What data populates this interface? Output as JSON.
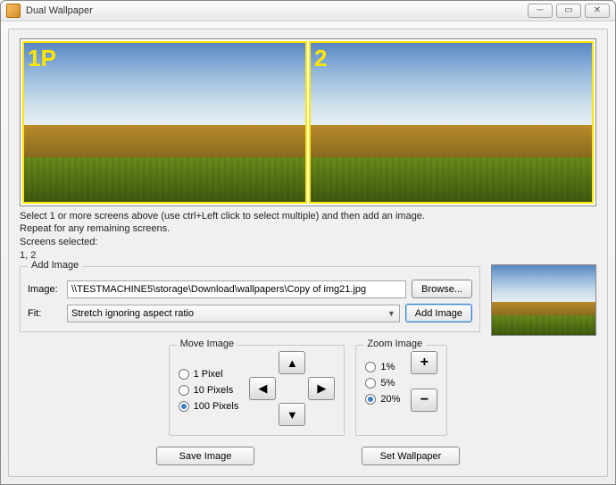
{
  "window": {
    "title": "Dual Wallpaper",
    "min_glyph": "─",
    "max_glyph": "▭",
    "close_glyph": "✕"
  },
  "screens": {
    "label1": "1P",
    "label2": "2"
  },
  "instructions": {
    "line1": "Select 1 or more screens above (use ctrl+Left click to select multiple) and then add an image.",
    "line2": "Repeat for any remaining screens.",
    "selected_label": "Screens selected:",
    "selected_value": "1, 2"
  },
  "add_image": {
    "group_title": "Add Image",
    "image_label": "Image:",
    "image_path": "\\\\TESTMACHINE5\\storage\\Download\\wallpapers\\Copy of img21.jpg",
    "browse": "Browse...",
    "fit_label": "Fit:",
    "fit_value": "Stretch ignoring aspect ratio",
    "add": "Add Image"
  },
  "move": {
    "title": "Move Image",
    "options": [
      "1 Pixel",
      "10 Pixels",
      "100 Pixels"
    ],
    "selected": 2,
    "up": "▲",
    "down": "▼",
    "left": "◀",
    "right": "▶"
  },
  "zoom": {
    "title": "Zoom Image",
    "options": [
      "1%",
      "5%",
      "20%"
    ],
    "selected": 2,
    "plus": "+",
    "minus": "−"
  },
  "bottom": {
    "save": "Save Image",
    "set": "Set Wallpaper"
  }
}
